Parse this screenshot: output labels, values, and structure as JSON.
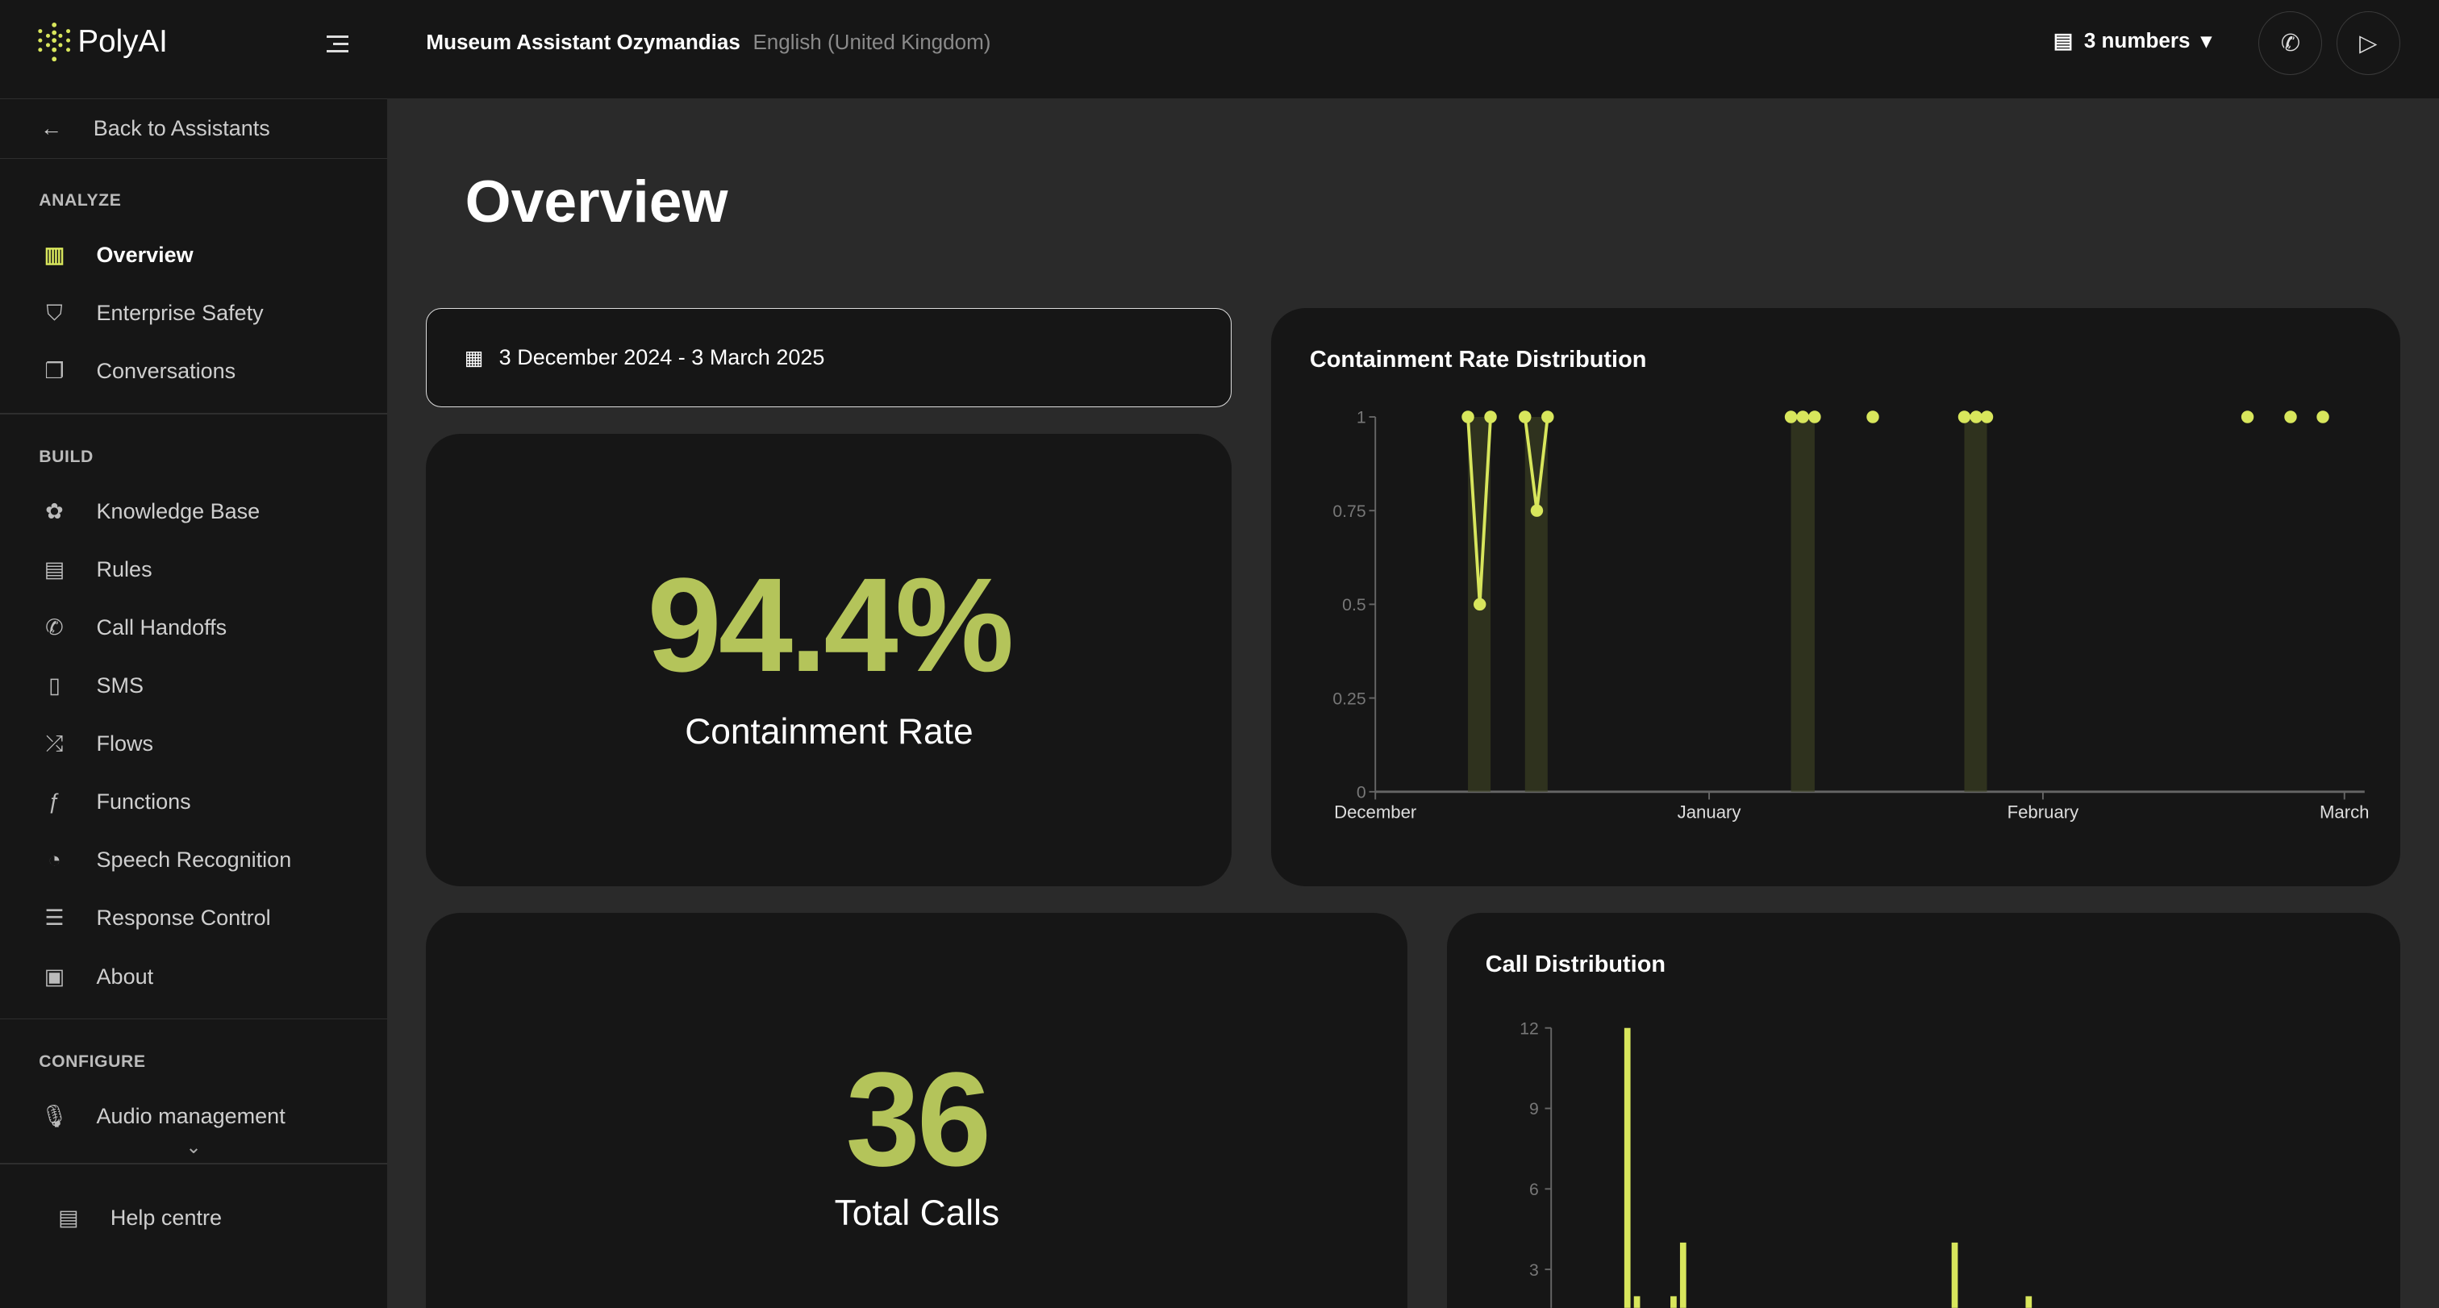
{
  "app": {
    "logo": "PolyAI",
    "assistant": "Museum Assistant Ozymandias",
    "language": "English (United Kingdom)",
    "numbers_label": "3 numbers"
  },
  "sidebar": {
    "back": "Back to Assistants",
    "sections": [
      {
        "title": "ANALYZE",
        "items": [
          {
            "label": "Overview",
            "icon": "bar-chart-icon",
            "active": true
          },
          {
            "label": "Enterprise Safety",
            "icon": "shield-icon"
          },
          {
            "label": "Conversations",
            "icon": "chat-icon"
          }
        ]
      },
      {
        "title": "BUILD",
        "items": [
          {
            "label": "Knowledge Base",
            "icon": "brain-icon"
          },
          {
            "label": "Rules",
            "icon": "list-icon"
          },
          {
            "label": "Call Handoffs",
            "icon": "phone-forward-icon"
          },
          {
            "label": "SMS",
            "icon": "sms-icon"
          },
          {
            "label": "Flows",
            "icon": "flow-icon"
          },
          {
            "label": "Functions",
            "icon": "function-icon"
          },
          {
            "label": "Speech Recognition",
            "icon": "ear-icon"
          },
          {
            "label": "Response Control",
            "icon": "response-icon"
          },
          {
            "label": "About",
            "icon": "clipboard-icon"
          }
        ]
      },
      {
        "title": "CONFIGURE",
        "items": [
          {
            "label": "Audio management",
            "icon": "microphone-icon"
          }
        ]
      }
    ],
    "help": "Help centre"
  },
  "page": {
    "title": "Overview",
    "date_range": "3 December 2024 - 3 March 2025",
    "containment_value": "94.4%",
    "containment_label": "Containment Rate",
    "calls_value": "36",
    "calls_label": "Total Calls"
  },
  "colors": {
    "accent": "#d8e65c",
    "big_number": "#b4c45a"
  },
  "chart_data": [
    {
      "type": "line",
      "title": "Containment Rate Distribution",
      "x_unit": "days since 1 December 2024",
      "x_ticks": [
        {
          "label": "December",
          "x": 0
        },
        {
          "label": "January",
          "x": 31
        },
        {
          "label": "February",
          "x": 62
        },
        {
          "label": "March",
          "x": 90
        }
      ],
      "y_ticks": [
        0,
        0.25,
        0.5,
        0.75,
        1
      ],
      "ylim": [
        0,
        1
      ],
      "xlim": [
        0,
        92
      ],
      "points": [
        [
          8.6,
          1
        ],
        [
          9.7,
          0.5
        ],
        [
          10.7,
          1
        ],
        [
          13.9,
          1
        ],
        [
          15,
          0.75
        ],
        [
          16,
          1
        ],
        [
          38.6,
          1
        ],
        [
          39.7,
          1
        ],
        [
          40.8,
          1
        ],
        [
          46.2,
          1
        ],
        [
          54.7,
          1
        ],
        [
          55.8,
          1
        ],
        [
          56.8,
          1
        ],
        [
          81,
          1
        ],
        [
          85,
          1
        ],
        [
          88,
          1
        ]
      ]
    },
    {
      "type": "bar",
      "title": "Call Distribution",
      "x_unit": "days since 1 December 2024",
      "y_ticks": [
        3,
        6,
        9,
        12
      ],
      "ylim": [
        0,
        12
      ],
      "bars": [
        [
          8.6,
          12
        ],
        [
          9.7,
          2
        ],
        [
          13.9,
          2
        ],
        [
          15,
          4
        ],
        [
          46.2,
          4
        ],
        [
          54.7,
          2
        ]
      ]
    }
  ]
}
